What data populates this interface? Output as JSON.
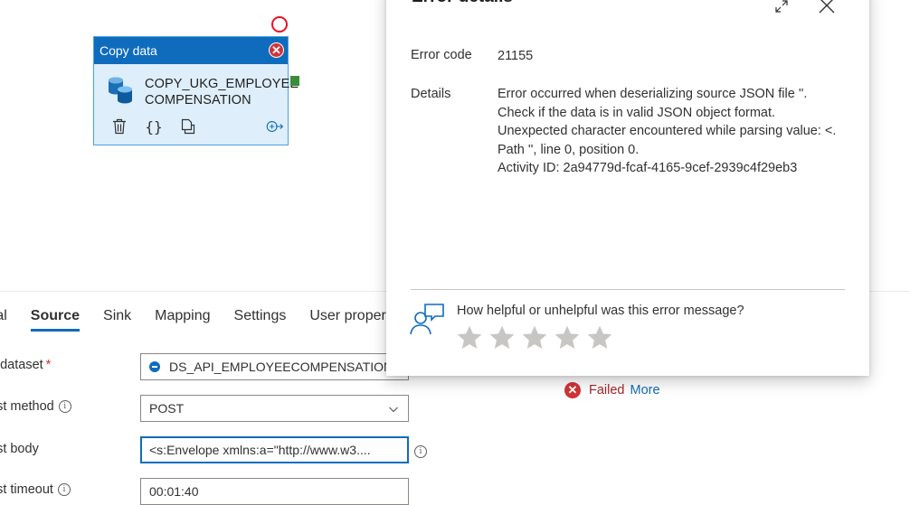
{
  "activity": {
    "type_label": "Copy data",
    "name_line1": "COPY_UKG_EMPLOYEE",
    "name_line2": "COMPENSATION",
    "icons": [
      "delete-icon",
      "code-icon",
      "clone-icon",
      "output-arrow-icon"
    ]
  },
  "tabs": [
    {
      "label": "ral",
      "active": false
    },
    {
      "label": "Source",
      "active": true
    },
    {
      "label": "Sink",
      "active": false
    },
    {
      "label": "Mapping",
      "active": false
    },
    {
      "label": "Settings",
      "active": false
    },
    {
      "label": "User proper",
      "active": false
    }
  ],
  "form": {
    "source_dataset": {
      "label": "e dataset",
      "required_mark": "*",
      "value": "DS_API_EMPLOYEECOMPENSATION"
    },
    "request_method": {
      "label": "est method",
      "info": "i",
      "value": "POST"
    },
    "request_body": {
      "label": "est body",
      "value": "<s:Envelope xmlns:a=\"http://www.w3...."
    },
    "request_timeout": {
      "label": "est timeout",
      "info": "i",
      "value": "00:01:40"
    }
  },
  "status": {
    "text": "Failed",
    "more": "More"
  },
  "error_details": {
    "title": "Error details",
    "code_label": "Error code",
    "code_value": "21155",
    "details_label": "Details",
    "details_lines": [
      "Error occurred when deserializing source JSON file ''.",
      "Check if the data is in valid JSON object format.",
      "Unexpected character encountered while parsing value: <.",
      "Path '', line 0, position 0.",
      "Activity ID: 2a94779d-fcaf-4165-9cef-2939c4f29eb3"
    ],
    "feedback_question": "How helpful or unhelpful was this error message?",
    "rating_max": 5,
    "rating_value": 0
  },
  "colors": {
    "accent": "#0f6cbd",
    "error": "#d13438",
    "node_bg": "#deeefb",
    "success_port": "#3a8d3a",
    "star_gray": "#c8c6c4"
  }
}
